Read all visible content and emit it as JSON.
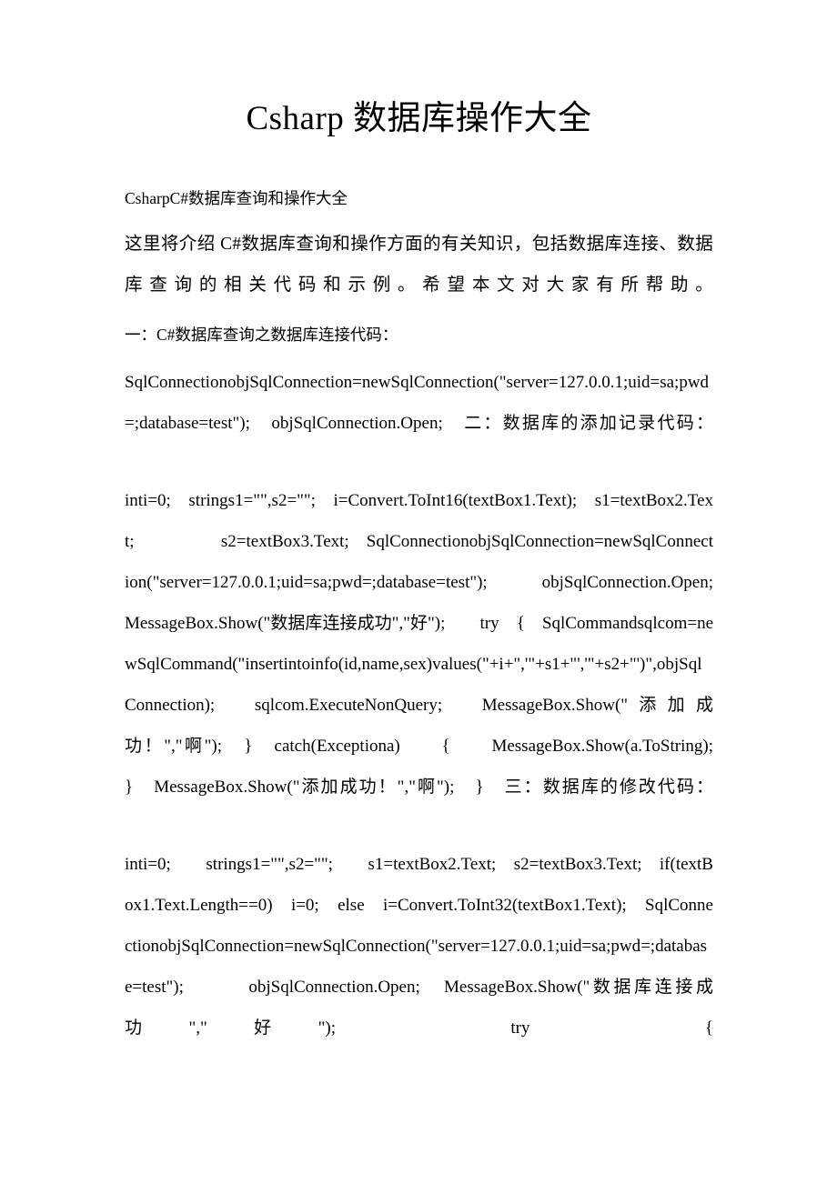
{
  "document": {
    "title": "Csharp 数据库操作大全",
    "subtitle": "CsharpC#数据库查询和操作大全",
    "intro": "这里将介绍 C#数据库查询和操作方面的有关知识，包括数据库连接、数据库查询的相关代码和示例。希望本文对大家有所帮助。",
    "section_one_heading": "一：C#数据库查询之数据库连接代码：",
    "code_block_one": "SqlConnectionobjSqlConnection=newSqlConnection(\"server=127.0.0.1;uid=sa;pwd=;database=test\");　objSqlConnection.Open;　二：数据库的添加记录代码：",
    "code_block_two": "inti=0;　strings1=\"\",s2=\"\";　i=Convert.ToInt16(textBox1.Text);　s1=textBox2.Text;　　　　　s2=textBox3.Text;　SqlConnectionobjSqlConnection=newSqlConnection(\"server=127.0.0.1;uid=sa;pwd=;database=test\");　　　objSqlConnection.Open;　MessageBox.Show(\"数据库连接成功\",\"好\");　　try　{　SqlCommandsqlcom=newSqlCommand(\"insertintoinfo(id,name,sex)values(\"+i+\",'\"+s1+\"','\"+s2+\"')\",objSqlConnection);　sqlcom.ExecuteNonQuery;　MessageBox.Show(\"添加成功！\",\"啊\");　}　catch(Exceptiona)　　{　　MessageBox.Show(a.ToString);　　}　MessageBox.Show(\"添加成功！\",\"啊\");　}　三：数据库的修改代码：",
    "code_block_three": "inti=0;　　strings1=\"\",s2=\"\";　　s1=textBox2.Text;　s2=textBox3.Text;　if(textBox1.Text.Length==0)　i=0;　else　i=Convert.ToInt32(textBox1.Text);　SqlConnectionobjSqlConnection=newSqlConnection(\"server=127.0.0.1;uid=sa;pwd=;database=test\");　　　objSqlConnection.Open;　MessageBox.Show(\"数据库连接成功\",\"好\");　　try　　{"
  }
}
